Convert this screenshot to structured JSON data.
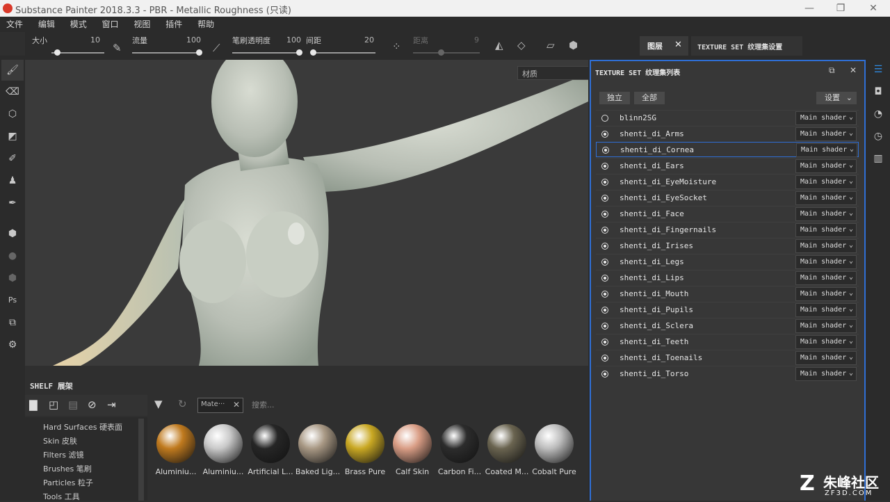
{
  "window": {
    "title": "Substance Painter 2018.3.3 - PBR - Metallic Roughness (只读)",
    "minimize": "—",
    "restore": "❐",
    "close": "✕"
  },
  "menu": [
    "文件",
    "编辑",
    "模式",
    "窗口",
    "视图",
    "插件",
    "帮助"
  ],
  "toolbar": {
    "size_label": "大小",
    "size_value": "10",
    "size_fraction": 0.1,
    "flow_label": "流量",
    "flow_value": "100",
    "flow_fraction": 1.0,
    "opacity_label": "笔刷透明度",
    "opacity_value": "100",
    "opacity_fraction": 1.0,
    "spacing_label": "间距",
    "spacing_value": "20",
    "spacing_fraction": 0.0,
    "distance_label": "距离",
    "distance_value": "9"
  },
  "viewport": {
    "select_value": "材质"
  },
  "shelf": {
    "title": "SHELF 展架",
    "categories": [
      "Hard Surfaces 硬表面",
      "Skin 皮肤",
      "Filters 滤镜",
      "Brushes 笔刷",
      "Particles 粒子",
      "Tools 工具"
    ],
    "filter_chip": "Mate···",
    "search_placeholder": "搜索...",
    "materials": [
      {
        "label": "Aluminiu...",
        "color": "#c07a1e"
      },
      {
        "label": "Aluminiu...",
        "color": "#c9c9c9"
      },
      {
        "label": "Artificial L...",
        "color": "#262626"
      },
      {
        "label": "Baked Lig...",
        "color": "#a89884"
      },
      {
        "label": "Brass Pure",
        "color": "#c9a823"
      },
      {
        "label": "Calf Skin",
        "color": "#d99d85"
      },
      {
        "label": "Carbon Fi...",
        "color": "#2c2c2c"
      },
      {
        "label": "Coated M...",
        "color": "#6a6450"
      },
      {
        "label": "Cobalt Pure",
        "color": "#bdbdbd"
      }
    ]
  },
  "panel": {
    "tab_layers": "图层",
    "tab_layers_close": "✕",
    "tab_tss": "TEXTURE SET 纹理集设置",
    "list_title": "TEXTURE SET 纹理集列表",
    "solo_btn": "独立",
    "all_btn": "全部",
    "settings_btn": "设置",
    "rows": [
      {
        "name": "blinn2SG",
        "shader": "Main shader",
        "on": false
      },
      {
        "name": "shenti_di_Arms",
        "shader": "Main shader",
        "on": true
      },
      {
        "name": "shenti_di_Cornea",
        "shader": "Main shader",
        "on": true
      },
      {
        "name": "shenti_di_Ears",
        "shader": "Main shader",
        "on": true
      },
      {
        "name": "shenti_di_EyeMoisture",
        "shader": "Main shader",
        "on": true
      },
      {
        "name": "shenti_di_EyeSocket",
        "shader": "Main shader",
        "on": true
      },
      {
        "name": "shenti_di_Face",
        "shader": "Main shader",
        "on": true
      },
      {
        "name": "shenti_di_Fingernails",
        "shader": "Main shader",
        "on": true
      },
      {
        "name": "shenti_di_Irises",
        "shader": "Main shader",
        "on": true
      },
      {
        "name": "shenti_di_Legs",
        "shader": "Main shader",
        "on": true
      },
      {
        "name": "shenti_di_Lips",
        "shader": "Main shader",
        "on": true
      },
      {
        "name": "shenti_di_Mouth",
        "shader": "Main shader",
        "on": true
      },
      {
        "name": "shenti_di_Pupils",
        "shader": "Main shader",
        "on": true
      },
      {
        "name": "shenti_di_Sclera",
        "shader": "Main shader",
        "on": true
      },
      {
        "name": "shenti_di_Teeth",
        "shader": "Main shader",
        "on": true
      },
      {
        "name": "shenti_di_Toenails",
        "shader": "Main shader",
        "on": true
      },
      {
        "name": "shenti_di_Torso",
        "shader": "Main shader",
        "on": true
      }
    ],
    "active_row": 2
  },
  "watermark": {
    "brand": "朱峰社区",
    "url": "ZF3D.COM"
  },
  "colors": {
    "accent": "#2f6fd6",
    "titlebar": "#f1f1f1",
    "logo": "#d9392a"
  }
}
